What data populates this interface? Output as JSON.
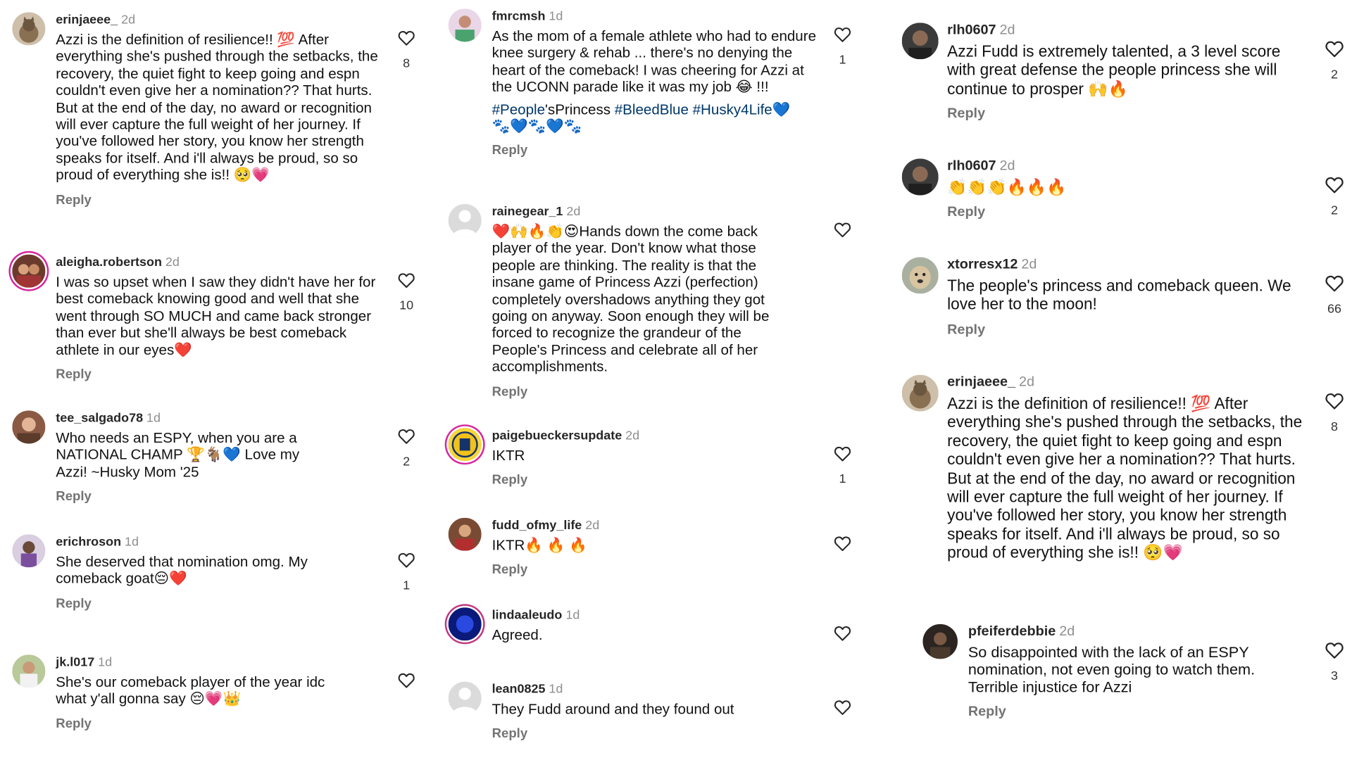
{
  "reply_label": "Reply",
  "colors": {
    "username": "#262626",
    "meta": "#8e8e8e",
    "hashtag": "#00376b",
    "story_ring": "#d6249f"
  },
  "columns": [
    {
      "comments": [
        {
          "username": "erinjaeee_",
          "age": "2d",
          "avatar": "cat-avatar",
          "likes": "8",
          "text": "Azzi is the definition of resilience!! 💯  After everything she's pushed through the setbacks, the recovery, the quiet fight to keep going and espn couldn't even give her a nomination?? That hurts. But at the end of the day, no award or recognition will ever capture the full weight of her journey. If you've followed her story, you know her strength speaks for itself. And i'll always be proud, so so proud of everything she is!! 🥺💗"
        },
        {
          "username": "aleigha.robertson",
          "age": "2d",
          "avatar": "group-photo-avatar",
          "likes": "10",
          "text": "I was so upset when I saw they didn't have her for best comeback knowing good and well that she went through SO MUCH and came back stronger than ever but she'll always be best comeback athlete in our eyes❤️"
        },
        {
          "username": "tee_salgado78",
          "age": "1d",
          "avatar": "person-avatar",
          "likes": "2",
          "text": "Who needs an ESPY, when you are a NATIONAL CHAMP 🏆🐐💙 Love my Azzi! ~Husky Mom '25"
        },
        {
          "username": "erichroson",
          "age": "1d",
          "avatar": "person-avatar",
          "likes": "1",
          "text": "She deserved that nomination omg. My comeback goat😔❤️"
        },
        {
          "username": "jk.l017",
          "age": "1d",
          "avatar": "person-avatar",
          "likes": "",
          "text": "She's our comeback player of the year idc what y'all gonna say 😔💗👑"
        }
      ]
    },
    {
      "comments": [
        {
          "username": "fmrcmsh",
          "age": "1d",
          "avatar": "person-avatar",
          "likes": "1",
          "text": "As the mom of a female athlete who had to endure knee surgery & rehab ... there's no denying the heart of the comeback! I was cheering for Azzi at the UCONN parade like it was my job 😂 !!!",
          "tags_line": "#People's Princess #BleedBlue #Husky4Life💙",
          "tag_1": "#People",
          "tag_1_rest": "'sPrincess",
          "tag_2": "#BleedBlue",
          "tag_3": "#Husky4Life",
          "tag_tail": "💙",
          "emoji_line": "🐾💙🐾💙🐾"
        },
        {
          "username": "rainegear_1",
          "age": "2d",
          "avatar": "default-avatar",
          "likes": "",
          "text": "❤️🙌🔥👏😍Hands down the come back player of the year. Don't know what those people are thinking. The reality is that the insane game of Princess Azzi (perfection) completely overshadows anything they got going on anyway. Soon enough they will be forced to recognize the grandeur of the People's Princess and celebrate all of her accomplishments."
        },
        {
          "username": "paigebueckersupdate",
          "age": "2d",
          "avatar": "jersey-logo-avatar",
          "likes": "1",
          "text": "IKTR"
        },
        {
          "username": "fudd_ofmy_life",
          "age": "2d",
          "avatar": "person-avatar",
          "likes": "",
          "text": "IKTR🔥 🔥 🔥"
        },
        {
          "username": "lindaaleudo",
          "age": "1d",
          "avatar": "blue-avatar",
          "likes": "",
          "text": "Agreed."
        },
        {
          "username": "lean0825",
          "age": "1d",
          "avatar": "default-avatar",
          "likes": "",
          "text": "They Fudd around and they found out"
        }
      ]
    },
    {
      "comments": [
        {
          "username": "rlh0607",
          "age": "2d",
          "avatar": "person-avatar",
          "likes": "2",
          "text": "Azzi Fudd is extremely talented, a 3 level score with great defense the people princess she will continue to prosper 🙌🔥"
        },
        {
          "username": "rlh0607",
          "age": "2d",
          "avatar": "person-avatar",
          "likes": "2",
          "text": "👏👏👏🔥🔥🔥"
        },
        {
          "username": "xtorresx12",
          "age": "2d",
          "avatar": "dog-avatar",
          "likes": "66",
          "text": "The people's princess and comeback queen. We love her to the moon!"
        },
        {
          "username": "erinjaeee_",
          "age": "2d",
          "avatar": "cat-avatar",
          "likes": "8",
          "text": "Azzi is the definition of resilience!! 💯  After everything she's pushed through the setbacks, the recovery, the quiet fight to keep going and espn couldn't even give her a nomination?? That hurts. But at the end of the day, no award or recognition will ever capture the full weight of her journey. If you've followed her story, you know her strength speaks for itself. And i'll always be proud, so so proud of everything she is!! 🥺💗"
        },
        {
          "username": "pfeiferdebbie",
          "age": "2d",
          "avatar": "person-avatar",
          "likes": "3",
          "text": "So disappointed with the lack of an ESPY nomination, not even going to watch them. Terrible injustice for Azzi"
        }
      ]
    }
  ]
}
